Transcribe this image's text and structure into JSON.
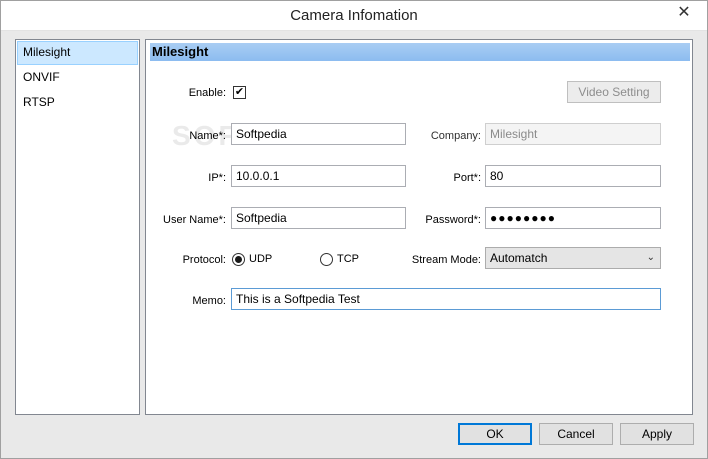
{
  "window": {
    "title": "Camera Infomation",
    "close_glyph": "✕"
  },
  "nav": {
    "items": [
      {
        "label": "Milesight",
        "selected": true
      },
      {
        "label": "ONVIF",
        "selected": false
      },
      {
        "label": "RTSP",
        "selected": false
      }
    ]
  },
  "panel": {
    "header": "Milesight",
    "enable": {
      "label": "Enable:",
      "checked": true,
      "check_glyph": "✔"
    },
    "video_setting_label": "Video Setting",
    "name": {
      "label": "Name*:",
      "value": "Softpedia"
    },
    "company": {
      "label": "Company:",
      "value": "Milesight"
    },
    "ip": {
      "label": "IP*:",
      "value": "10.0.0.1"
    },
    "port": {
      "label": "Port*:",
      "value": "80"
    },
    "username": {
      "label": "User Name*:",
      "value": "Softpedia"
    },
    "password": {
      "label": "Password*:",
      "value": "●●●●●●●●"
    },
    "protocol": {
      "label": "Protocol:",
      "options": [
        {
          "label": "UDP",
          "checked": true
        },
        {
          "label": "TCP",
          "checked": false
        }
      ]
    },
    "stream_mode": {
      "label": "Stream Mode:",
      "value": "Automatch",
      "arrow_glyph": "⌄"
    },
    "memo": {
      "label": "Memo:",
      "value": "This is a Softpedia Test"
    },
    "watermark": "SOFTPEDIA"
  },
  "buttons": {
    "ok": "OK",
    "cancel": "Cancel",
    "apply": "Apply"
  },
  "colors": {
    "accent": "#0078d7",
    "header_bg": "#8cbcf0",
    "selection": "#cce8ff"
  }
}
